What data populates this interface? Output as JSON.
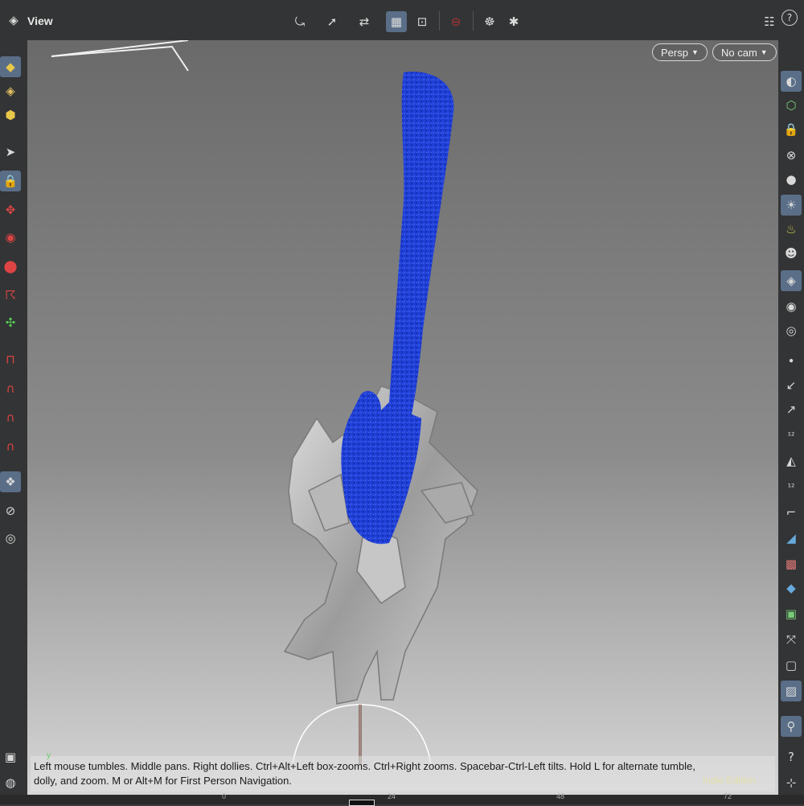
{
  "toolbar": {
    "title": "View",
    "icons": [
      "viewport-menu-icon",
      "tumble-icon",
      "pan-icon",
      "dolly-icon",
      "camera-view-icon",
      "zoom-frame-icon",
      "no-entry-icon",
      "render-icon",
      "settings-icon",
      "layout-icon",
      "help-icon"
    ]
  },
  "viewport": {
    "persp_label": "Persp",
    "cam_label": "No cam",
    "help_line1": "Left mouse tumbles. Middle pans. Right dollies. Ctrl+Alt+Left box-zooms. Ctrl+Right zooms. Spacebar-Ctrl-Left tilts. Hold L for alternate tumble,",
    "help_line2": "dolly, and zoom.    M or Alt+M for First Person Navigation.",
    "edition": "Indie Edition",
    "axis_y": "y"
  },
  "timeline": {
    "ticks": [
      "0",
      "24",
      "48",
      "72"
    ]
  },
  "colors": {
    "particles": "#1f3fd6",
    "toolbar": "#333435",
    "active": "#5a6e88"
  }
}
